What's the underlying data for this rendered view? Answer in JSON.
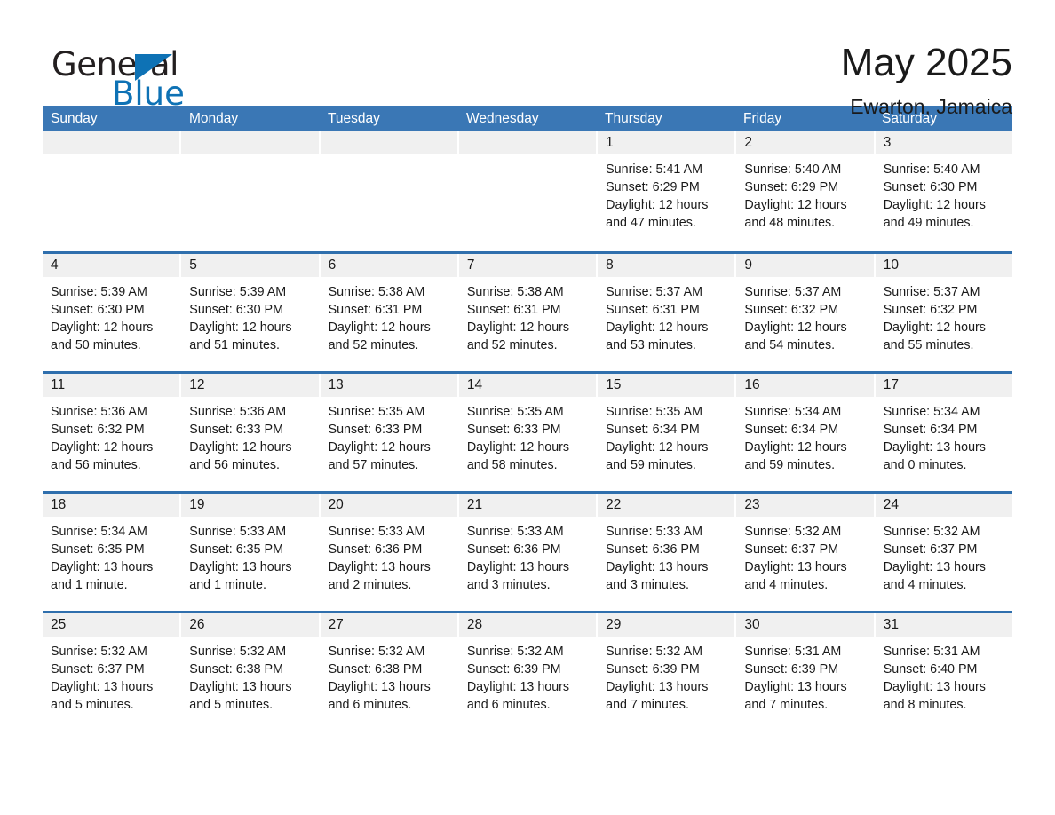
{
  "logo": {
    "text_primary": "General",
    "text_secondary": "Blue",
    "triangle_icon": "logo-triangle-icon",
    "brand_color": "#0e72b5"
  },
  "header": {
    "month_title": "May 2025",
    "location": "Ewarton, Jamaica"
  },
  "calendar": {
    "header_color": "#3a77b5",
    "row_divider_color": "#2f6fad",
    "day_band_color": "#f0f0f0",
    "weekdays": [
      "Sunday",
      "Monday",
      "Tuesday",
      "Wednesday",
      "Thursday",
      "Friday",
      "Saturday"
    ],
    "weeks": [
      [
        {
          "day": "",
          "empty": true
        },
        {
          "day": "",
          "empty": true
        },
        {
          "day": "",
          "empty": true
        },
        {
          "day": "",
          "empty": true
        },
        {
          "day": "1",
          "sunrise": "Sunrise: 5:41 AM",
          "sunset": "Sunset: 6:29 PM",
          "daylight_line1": "Daylight: 12 hours",
          "daylight_line2": "and 47 minutes."
        },
        {
          "day": "2",
          "sunrise": "Sunrise: 5:40 AM",
          "sunset": "Sunset: 6:29 PM",
          "daylight_line1": "Daylight: 12 hours",
          "daylight_line2": "and 48 minutes."
        },
        {
          "day": "3",
          "sunrise": "Sunrise: 5:40 AM",
          "sunset": "Sunset: 6:30 PM",
          "daylight_line1": "Daylight: 12 hours",
          "daylight_line2": "and 49 minutes."
        }
      ],
      [
        {
          "day": "4",
          "sunrise": "Sunrise: 5:39 AM",
          "sunset": "Sunset: 6:30 PM",
          "daylight_line1": "Daylight: 12 hours",
          "daylight_line2": "and 50 minutes."
        },
        {
          "day": "5",
          "sunrise": "Sunrise: 5:39 AM",
          "sunset": "Sunset: 6:30 PM",
          "daylight_line1": "Daylight: 12 hours",
          "daylight_line2": "and 51 minutes."
        },
        {
          "day": "6",
          "sunrise": "Sunrise: 5:38 AM",
          "sunset": "Sunset: 6:31 PM",
          "daylight_line1": "Daylight: 12 hours",
          "daylight_line2": "and 52 minutes."
        },
        {
          "day": "7",
          "sunrise": "Sunrise: 5:38 AM",
          "sunset": "Sunset: 6:31 PM",
          "daylight_line1": "Daylight: 12 hours",
          "daylight_line2": "and 52 minutes."
        },
        {
          "day": "8",
          "sunrise": "Sunrise: 5:37 AM",
          "sunset": "Sunset: 6:31 PM",
          "daylight_line1": "Daylight: 12 hours",
          "daylight_line2": "and 53 minutes."
        },
        {
          "day": "9",
          "sunrise": "Sunrise: 5:37 AM",
          "sunset": "Sunset: 6:32 PM",
          "daylight_line1": "Daylight: 12 hours",
          "daylight_line2": "and 54 minutes."
        },
        {
          "day": "10",
          "sunrise": "Sunrise: 5:37 AM",
          "sunset": "Sunset: 6:32 PM",
          "daylight_line1": "Daylight: 12 hours",
          "daylight_line2": "and 55 minutes."
        }
      ],
      [
        {
          "day": "11",
          "sunrise": "Sunrise: 5:36 AM",
          "sunset": "Sunset: 6:32 PM",
          "daylight_line1": "Daylight: 12 hours",
          "daylight_line2": "and 56 minutes."
        },
        {
          "day": "12",
          "sunrise": "Sunrise: 5:36 AM",
          "sunset": "Sunset: 6:33 PM",
          "daylight_line1": "Daylight: 12 hours",
          "daylight_line2": "and 56 minutes."
        },
        {
          "day": "13",
          "sunrise": "Sunrise: 5:35 AM",
          "sunset": "Sunset: 6:33 PM",
          "daylight_line1": "Daylight: 12 hours",
          "daylight_line2": "and 57 minutes."
        },
        {
          "day": "14",
          "sunrise": "Sunrise: 5:35 AM",
          "sunset": "Sunset: 6:33 PM",
          "daylight_line1": "Daylight: 12 hours",
          "daylight_line2": "and 58 minutes."
        },
        {
          "day": "15",
          "sunrise": "Sunrise: 5:35 AM",
          "sunset": "Sunset: 6:34 PM",
          "daylight_line1": "Daylight: 12 hours",
          "daylight_line2": "and 59 minutes."
        },
        {
          "day": "16",
          "sunrise": "Sunrise: 5:34 AM",
          "sunset": "Sunset: 6:34 PM",
          "daylight_line1": "Daylight: 12 hours",
          "daylight_line2": "and 59 minutes."
        },
        {
          "day": "17",
          "sunrise": "Sunrise: 5:34 AM",
          "sunset": "Sunset: 6:34 PM",
          "daylight_line1": "Daylight: 13 hours",
          "daylight_line2": "and 0 minutes."
        }
      ],
      [
        {
          "day": "18",
          "sunrise": "Sunrise: 5:34 AM",
          "sunset": "Sunset: 6:35 PM",
          "daylight_line1": "Daylight: 13 hours",
          "daylight_line2": "and 1 minute."
        },
        {
          "day": "19",
          "sunrise": "Sunrise: 5:33 AM",
          "sunset": "Sunset: 6:35 PM",
          "daylight_line1": "Daylight: 13 hours",
          "daylight_line2": "and 1 minute."
        },
        {
          "day": "20",
          "sunrise": "Sunrise: 5:33 AM",
          "sunset": "Sunset: 6:36 PM",
          "daylight_line1": "Daylight: 13 hours",
          "daylight_line2": "and 2 minutes."
        },
        {
          "day": "21",
          "sunrise": "Sunrise: 5:33 AM",
          "sunset": "Sunset: 6:36 PM",
          "daylight_line1": "Daylight: 13 hours",
          "daylight_line2": "and 3 minutes."
        },
        {
          "day": "22",
          "sunrise": "Sunrise: 5:33 AM",
          "sunset": "Sunset: 6:36 PM",
          "daylight_line1": "Daylight: 13 hours",
          "daylight_line2": "and 3 minutes."
        },
        {
          "day": "23",
          "sunrise": "Sunrise: 5:32 AM",
          "sunset": "Sunset: 6:37 PM",
          "daylight_line1": "Daylight: 13 hours",
          "daylight_line2": "and 4 minutes."
        },
        {
          "day": "24",
          "sunrise": "Sunrise: 5:32 AM",
          "sunset": "Sunset: 6:37 PM",
          "daylight_line1": "Daylight: 13 hours",
          "daylight_line2": "and 4 minutes."
        }
      ],
      [
        {
          "day": "25",
          "sunrise": "Sunrise: 5:32 AM",
          "sunset": "Sunset: 6:37 PM",
          "daylight_line1": "Daylight: 13 hours",
          "daylight_line2": "and 5 minutes."
        },
        {
          "day": "26",
          "sunrise": "Sunrise: 5:32 AM",
          "sunset": "Sunset: 6:38 PM",
          "daylight_line1": "Daylight: 13 hours",
          "daylight_line2": "and 5 minutes."
        },
        {
          "day": "27",
          "sunrise": "Sunrise: 5:32 AM",
          "sunset": "Sunset: 6:38 PM",
          "daylight_line1": "Daylight: 13 hours",
          "daylight_line2": "and 6 minutes."
        },
        {
          "day": "28",
          "sunrise": "Sunrise: 5:32 AM",
          "sunset": "Sunset: 6:39 PM",
          "daylight_line1": "Daylight: 13 hours",
          "daylight_line2": "and 6 minutes."
        },
        {
          "day": "29",
          "sunrise": "Sunrise: 5:32 AM",
          "sunset": "Sunset: 6:39 PM",
          "daylight_line1": "Daylight: 13 hours",
          "daylight_line2": "and 7 minutes."
        },
        {
          "day": "30",
          "sunrise": "Sunrise: 5:31 AM",
          "sunset": "Sunset: 6:39 PM",
          "daylight_line1": "Daylight: 13 hours",
          "daylight_line2": "and 7 minutes."
        },
        {
          "day": "31",
          "sunrise": "Sunrise: 5:31 AM",
          "sunset": "Sunset: 6:40 PM",
          "daylight_line1": "Daylight: 13 hours",
          "daylight_line2": "and 8 minutes."
        }
      ]
    ]
  }
}
